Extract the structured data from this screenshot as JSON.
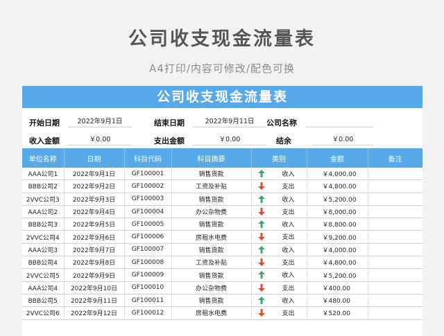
{
  "page": {
    "title": "公司收支现金流量表",
    "subtitle": "A4打印/内容可修改/配色可换"
  },
  "sheet": {
    "title": "公司收支现金流量表",
    "start_date_label": "开始日期",
    "start_date": "2022年9月1日",
    "end_date_label": "结束日期",
    "end_date": "2022年9月11日",
    "company_label": "公司名称",
    "company_value": "",
    "income_label": "收入金额",
    "income_value": "￥0.00",
    "expense_label": "支出金额",
    "expense_value": "￥0.00",
    "balance_label": "结余",
    "balance_value": "￥0.00"
  },
  "colors": {
    "header_blue": "#57a9ea",
    "income_arrow": "#43a56a",
    "expense_arrow": "#d6522f"
  },
  "table": {
    "columns": [
      "单位名称",
      "日期",
      "科目代码",
      "科目摘要",
      "类别",
      "金额",
      "备注"
    ],
    "rows": [
      {
        "unit": "AAA公司1",
        "date": "2022年9月1日",
        "code": "GF100001",
        "summary": "销售货款",
        "dir": "up",
        "type": "收入",
        "amount": "￥4,000.00",
        "note": ""
      },
      {
        "unit": "BBB公司2",
        "date": "2022年9月2日",
        "code": "GF100002",
        "summary": "工资及补贴",
        "dir": "down",
        "type": "支出",
        "amount": "￥4,800.00",
        "note": ""
      },
      {
        "unit": "2VVC公司3",
        "date": "2022年9月3日",
        "code": "GF100003",
        "summary": "销售货款",
        "dir": "up",
        "type": "收入",
        "amount": "￥5,200.00",
        "note": ""
      },
      {
        "unit": "AAA公司2",
        "date": "2022年9月4日",
        "code": "GF100004",
        "summary": "办公杂物费",
        "dir": "down",
        "type": "支出",
        "amount": "￥8,000.00",
        "note": ""
      },
      {
        "unit": "BBB公司3",
        "date": "2022年9月5日",
        "code": "GF100005",
        "summary": "销售货款",
        "dir": "up",
        "type": "收入",
        "amount": "￥8,800.00",
        "note": ""
      },
      {
        "unit": "2VVC公司4",
        "date": "2022年9月6日",
        "code": "GF100006",
        "summary": "房租水电费",
        "dir": "down",
        "type": "支出",
        "amount": "￥9,200.00",
        "note": ""
      },
      {
        "unit": "AAA公司3",
        "date": "2022年9月7日",
        "code": "GF100007",
        "summary": "销售货款",
        "dir": "up",
        "type": "收入",
        "amount": "￥4,000.00",
        "note": ""
      },
      {
        "unit": "BBB公司4",
        "date": "2022年9月8日",
        "code": "GF100008",
        "summary": "工资及补贴",
        "dir": "down",
        "type": "支出",
        "amount": "￥4,800.00",
        "note": ""
      },
      {
        "unit": "2VVC公司5",
        "date": "2022年9月9日",
        "code": "GF100009",
        "summary": "销售货款",
        "dir": "up",
        "type": "收入",
        "amount": "￥5,200.00",
        "note": ""
      },
      {
        "unit": "AAA公司4",
        "date": "2022年9月10日",
        "code": "GF100010",
        "summary": "办公杂物费",
        "dir": "down",
        "type": "支出",
        "amount": "￥400.00",
        "note": ""
      },
      {
        "unit": "BBB公司5",
        "date": "2022年9月11日",
        "code": "GF100011",
        "summary": "销售货款",
        "dir": "up",
        "type": "收入",
        "amount": "￥480.00",
        "note": ""
      },
      {
        "unit": "2VVC公司6",
        "date": "2022年9月12日",
        "code": "GF100012",
        "summary": "房租水电费",
        "dir": "down",
        "type": "支出",
        "amount": "￥520.00",
        "note": ""
      }
    ]
  }
}
